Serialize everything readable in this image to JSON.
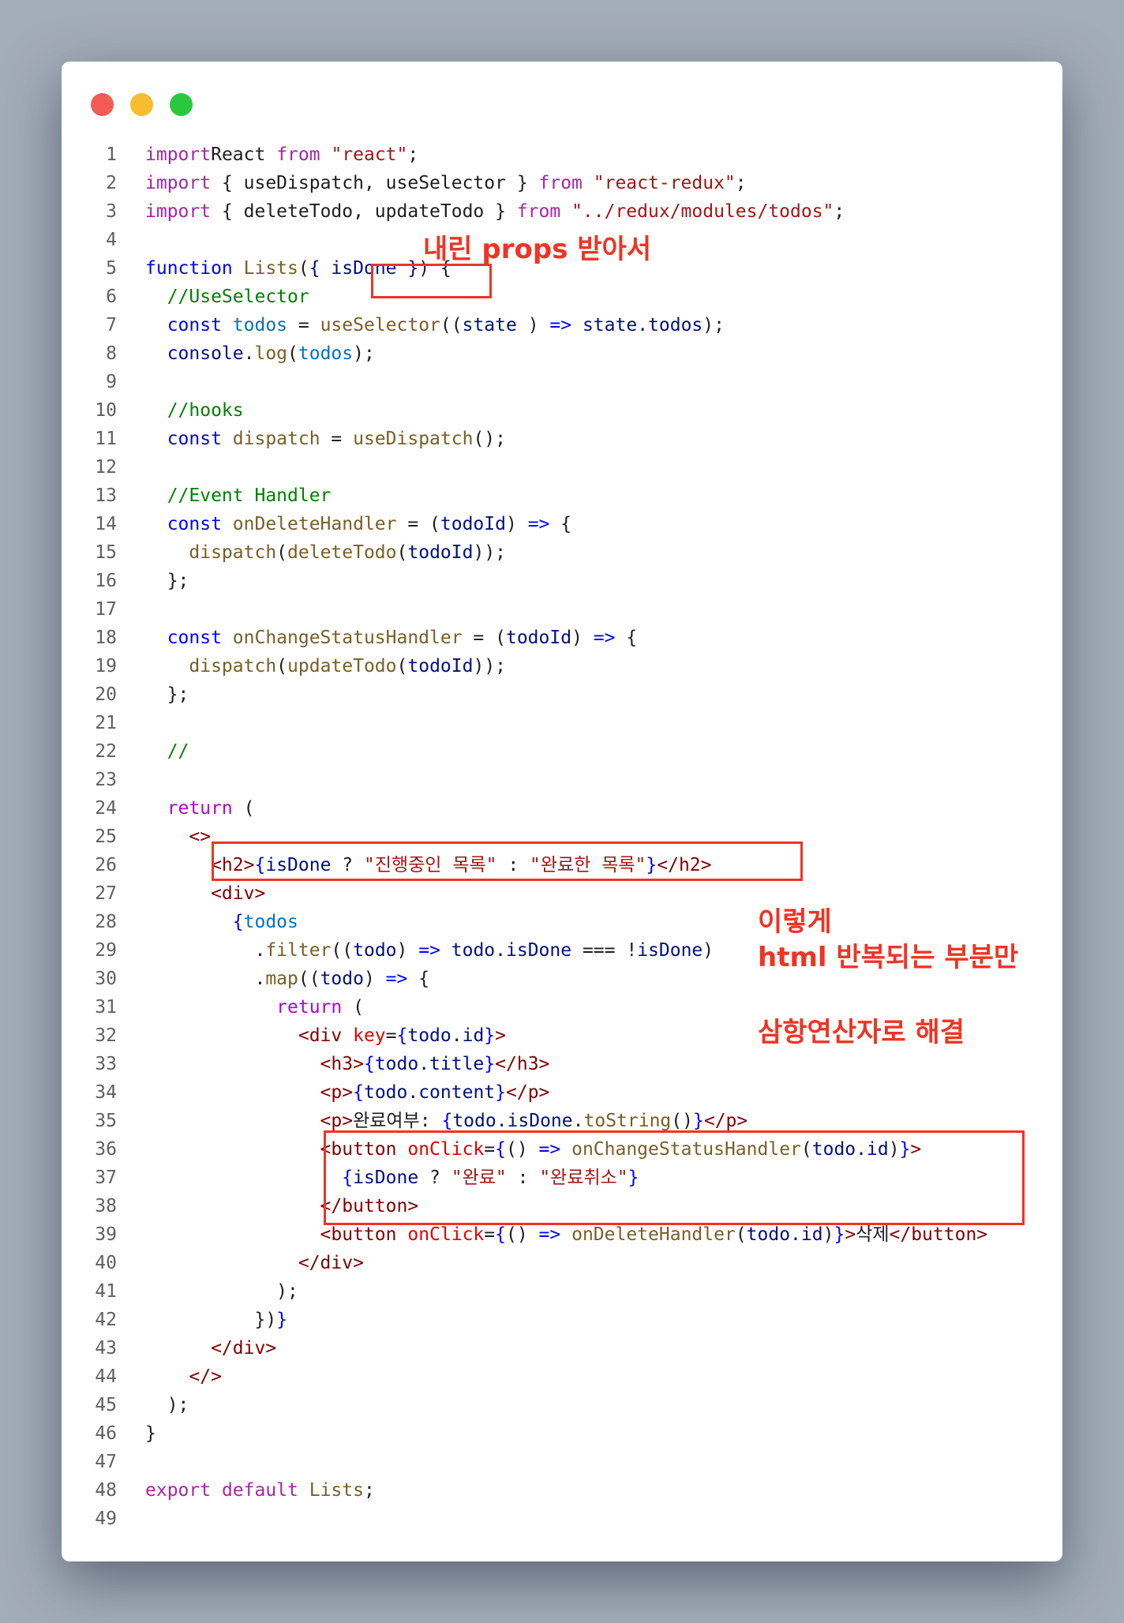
{
  "window": {
    "controls": [
      "close",
      "minimize",
      "zoom"
    ],
    "colors": {
      "close": "#f45b55",
      "minimize": "#f6bd2f",
      "zoom": "#2ac73f",
      "annotation": "#ee3424"
    }
  },
  "lines": [
    {
      "num": "1",
      "tokens": [
        [
          "kw",
          "import"
        ],
        [
          "",
          "React"
        ],
        [
          "kw",
          " from"
        ],
        [
          "str",
          " \"react\""
        ],
        [
          "",
          ";"
        ]
      ]
    },
    {
      "num": "2",
      "tokens": [
        [
          "kw",
          "import"
        ],
        [
          "",
          " { useDispatch, useSelector }"
        ],
        [
          "kw",
          " from"
        ],
        [
          "str",
          " \"react-redux\""
        ],
        [
          "",
          ";"
        ]
      ]
    },
    {
      "num": "3",
      "tokens": [
        [
          "kw",
          "import"
        ],
        [
          "",
          " { deleteTodo, updateTodo }"
        ],
        [
          "kw",
          " from"
        ],
        [
          "str",
          " \"../redux/modules/todos\""
        ],
        [
          "",
          ";"
        ]
      ]
    },
    {
      "num": "4",
      "tokens": []
    },
    {
      "num": "5",
      "tokens": [
        [
          "dec",
          "function"
        ],
        [
          "fn",
          " Lists"
        ],
        [
          "",
          "("
        ],
        [
          "prm",
          "{ isDone }"
        ],
        [
          "",
          ") {"
        ]
      ]
    },
    {
      "num": "6",
      "tokens": [
        [
          "cm",
          "  //UseSelector"
        ]
      ]
    },
    {
      "num": "7",
      "tokens": [
        [
          "dec",
          "  const"
        ],
        [
          "var",
          " todos"
        ],
        [
          "",
          " = "
        ],
        [
          "fn",
          "useSelector"
        ],
        [
          "",
          "(("
        ],
        [
          "prm",
          "state"
        ],
        [
          "",
          " ) "
        ],
        [
          "brc",
          "=>"
        ],
        [
          "prm",
          " state.todos"
        ],
        [
          "",
          ");"
        ]
      ]
    },
    {
      "num": "8",
      "tokens": [
        [
          "prm",
          "  console"
        ],
        [
          "",
          "."
        ],
        [
          "fn",
          "log"
        ],
        [
          "",
          "("
        ],
        [
          "var",
          "todos"
        ],
        [
          "",
          ");"
        ]
      ]
    },
    {
      "num": "9",
      "tokens": []
    },
    {
      "num": "10",
      "tokens": [
        [
          "cm",
          "  //hooks"
        ]
      ]
    },
    {
      "num": "11",
      "tokens": [
        [
          "dec",
          "  const"
        ],
        [
          "fn",
          " dispatch"
        ],
        [
          "",
          " = "
        ],
        [
          "fn",
          "useDispatch"
        ],
        [
          "",
          "();"
        ]
      ]
    },
    {
      "num": "12",
      "tokens": []
    },
    {
      "num": "13",
      "tokens": [
        [
          "cm",
          "  //Event Handler"
        ]
      ]
    },
    {
      "num": "14",
      "tokens": [
        [
          "dec",
          "  const"
        ],
        [
          "fn",
          " onDeleteHandler"
        ],
        [
          "",
          " = ("
        ],
        [
          "prm",
          "todoId"
        ],
        [
          "",
          ") "
        ],
        [
          "brc",
          "=>"
        ],
        [
          "",
          " {"
        ]
      ]
    },
    {
      "num": "15",
      "tokens": [
        [
          "fn",
          "    dispatch"
        ],
        [
          "",
          "("
        ],
        [
          "fn",
          "deleteTodo"
        ],
        [
          "",
          "("
        ],
        [
          "prm",
          "todoId"
        ],
        [
          "",
          "));"
        ]
      ]
    },
    {
      "num": "16",
      "tokens": [
        [
          "",
          "  };"
        ]
      ]
    },
    {
      "num": "17",
      "tokens": []
    },
    {
      "num": "18",
      "tokens": [
        [
          "dec",
          "  const"
        ],
        [
          "fn",
          " onChangeStatusHandler"
        ],
        [
          "",
          " = ("
        ],
        [
          "prm",
          "todoId"
        ],
        [
          "",
          ") "
        ],
        [
          "brc",
          "=>"
        ],
        [
          "",
          " {"
        ]
      ]
    },
    {
      "num": "19",
      "tokens": [
        [
          "fn",
          "    dispatch"
        ],
        [
          "",
          "("
        ],
        [
          "fn",
          "updateTodo"
        ],
        [
          "",
          "("
        ],
        [
          "prm",
          "todoId"
        ],
        [
          "",
          "));"
        ]
      ]
    },
    {
      "num": "20",
      "tokens": [
        [
          "",
          "  };"
        ]
      ]
    },
    {
      "num": "21",
      "tokens": []
    },
    {
      "num": "22",
      "tokens": [
        [
          "cm",
          "  //"
        ]
      ]
    },
    {
      "num": "23",
      "tokens": []
    },
    {
      "num": "24",
      "tokens": [
        [
          "ctl",
          "  return"
        ],
        [
          "",
          " ("
        ]
      ]
    },
    {
      "num": "25",
      "tokens": [
        [
          "tag",
          "    <>"
        ]
      ]
    },
    {
      "num": "26",
      "tokens": [
        [
          "tag",
          "      <h2>"
        ],
        [
          "brc",
          "{"
        ],
        [
          "prm",
          "isDone"
        ],
        [
          "",
          " ? "
        ],
        [
          "str",
          "\"진행중인 목록\""
        ],
        [
          "",
          " : "
        ],
        [
          "str",
          "\"완료한 목록\""
        ],
        [
          "brc",
          "}"
        ],
        [
          "tag",
          "</h2>"
        ]
      ]
    },
    {
      "num": "27",
      "tokens": [
        [
          "tag",
          "      <div>"
        ]
      ]
    },
    {
      "num": "28",
      "tokens": [
        [
          "brc",
          "        {"
        ],
        [
          "var",
          "todos"
        ]
      ]
    },
    {
      "num": "29",
      "tokens": [
        [
          "",
          "          ."
        ],
        [
          "fn",
          "filter"
        ],
        [
          "",
          "(("
        ],
        [
          "prm",
          "todo"
        ],
        [
          "",
          ") "
        ],
        [
          "brc",
          "=>"
        ],
        [
          "prm",
          " todo.isDone"
        ],
        [
          "",
          " === !"
        ],
        [
          "prm",
          "isDone"
        ],
        [
          "",
          ")"
        ]
      ]
    },
    {
      "num": "30",
      "tokens": [
        [
          "",
          "          ."
        ],
        [
          "fn",
          "map"
        ],
        [
          "",
          "(("
        ],
        [
          "prm",
          "todo"
        ],
        [
          "",
          ") "
        ],
        [
          "brc",
          "=>"
        ],
        [
          "",
          " {"
        ]
      ]
    },
    {
      "num": "31",
      "tokens": [
        [
          "ctl",
          "            return"
        ],
        [
          "",
          " ("
        ]
      ]
    },
    {
      "num": "32",
      "tokens": [
        [
          "tag",
          "              <div"
        ],
        [
          "attr",
          " key"
        ],
        [
          "",
          "="
        ],
        [
          "brc",
          "{"
        ],
        [
          "prm",
          "todo.id"
        ],
        [
          "brc",
          "}"
        ],
        [
          "tag",
          ">"
        ]
      ]
    },
    {
      "num": "33",
      "tokens": [
        [
          "tag",
          "                <h3>"
        ],
        [
          "brc",
          "{"
        ],
        [
          "prm",
          "todo.title"
        ],
        [
          "brc",
          "}"
        ],
        [
          "tag",
          "</h3>"
        ]
      ]
    },
    {
      "num": "34",
      "tokens": [
        [
          "tag",
          "                <p>"
        ],
        [
          "brc",
          "{"
        ],
        [
          "prm",
          "todo.content"
        ],
        [
          "brc",
          "}"
        ],
        [
          "tag",
          "</p>"
        ]
      ]
    },
    {
      "num": "35",
      "tokens": [
        [
          "tag",
          "                <p>"
        ],
        [
          "",
          "완료여부: "
        ],
        [
          "brc",
          "{"
        ],
        [
          "prm",
          "todo.isDone"
        ],
        [
          "",
          "."
        ],
        [
          "fn",
          "toString"
        ],
        [
          "",
          "()"
        ],
        [
          "brc",
          "}"
        ],
        [
          "tag",
          "</p>"
        ]
      ]
    },
    {
      "num": "36",
      "tokens": [
        [
          "tag",
          "                <button"
        ],
        [
          "attr",
          " onClick"
        ],
        [
          "",
          "="
        ],
        [
          "brc",
          "{"
        ],
        [
          "",
          "() "
        ],
        [
          "brc",
          "=>"
        ],
        [
          "fn",
          " onChangeStatusHandler"
        ],
        [
          "",
          "("
        ],
        [
          "prm",
          "todo.id"
        ],
        [
          "",
          ")"
        ],
        [
          "brc",
          "}"
        ],
        [
          "tag",
          ">"
        ]
      ]
    },
    {
      "num": "37",
      "tokens": [
        [
          "brc",
          "                  {"
        ],
        [
          "prm",
          "isDone"
        ],
        [
          "",
          " ? "
        ],
        [
          "str",
          "\"완료\""
        ],
        [
          "",
          " : "
        ],
        [
          "str",
          "\"완료취소\""
        ],
        [
          "brc",
          "}"
        ]
      ]
    },
    {
      "num": "38",
      "tokens": [
        [
          "tag",
          "                </button>"
        ]
      ]
    },
    {
      "num": "39",
      "tokens": [
        [
          "tag",
          "                <button"
        ],
        [
          "attr",
          " onClick"
        ],
        [
          "",
          "="
        ],
        [
          "brc",
          "{"
        ],
        [
          "",
          "() "
        ],
        [
          "brc",
          "=>"
        ],
        [
          "fn",
          " onDeleteHandler"
        ],
        [
          "",
          "("
        ],
        [
          "prm",
          "todo.id"
        ],
        [
          "",
          ")"
        ],
        [
          "brc",
          "}"
        ],
        [
          "tag",
          ">"
        ],
        [
          "",
          "삭제"
        ],
        [
          "tag",
          "</button>"
        ]
      ]
    },
    {
      "num": "40",
      "tokens": [
        [
          "tag",
          "              </div>"
        ]
      ]
    },
    {
      "num": "41",
      "tokens": [
        [
          "",
          "            );"
        ]
      ]
    },
    {
      "num": "42",
      "tokens": [
        [
          "",
          "          })"
        ],
        [
          "brc",
          "}"
        ]
      ]
    },
    {
      "num": "43",
      "tokens": [
        [
          "tag",
          "      </div>"
        ]
      ]
    },
    {
      "num": "44",
      "tokens": [
        [
          "tag",
          "    </>"
        ]
      ]
    },
    {
      "num": "45",
      "tokens": [
        [
          "",
          "  );"
        ]
      ]
    },
    {
      "num": "46",
      "tokens": [
        [
          "",
          "}"
        ]
      ]
    },
    {
      "num": "47",
      "tokens": []
    },
    {
      "num": "48",
      "tokens": [
        [
          "kw",
          "export"
        ],
        [
          "kw",
          " default"
        ],
        [
          "fn",
          " Lists"
        ],
        [
          "",
          ";"
        ]
      ]
    },
    {
      "num": "49",
      "tokens": []
    }
  ],
  "annotations": {
    "props_note": "내린 props 받아서",
    "loop_note_line1": "이렇게",
    "loop_note_line2": "html 반복되는 부분만",
    "loop_note_line3": "삼항연산자로 해결"
  }
}
